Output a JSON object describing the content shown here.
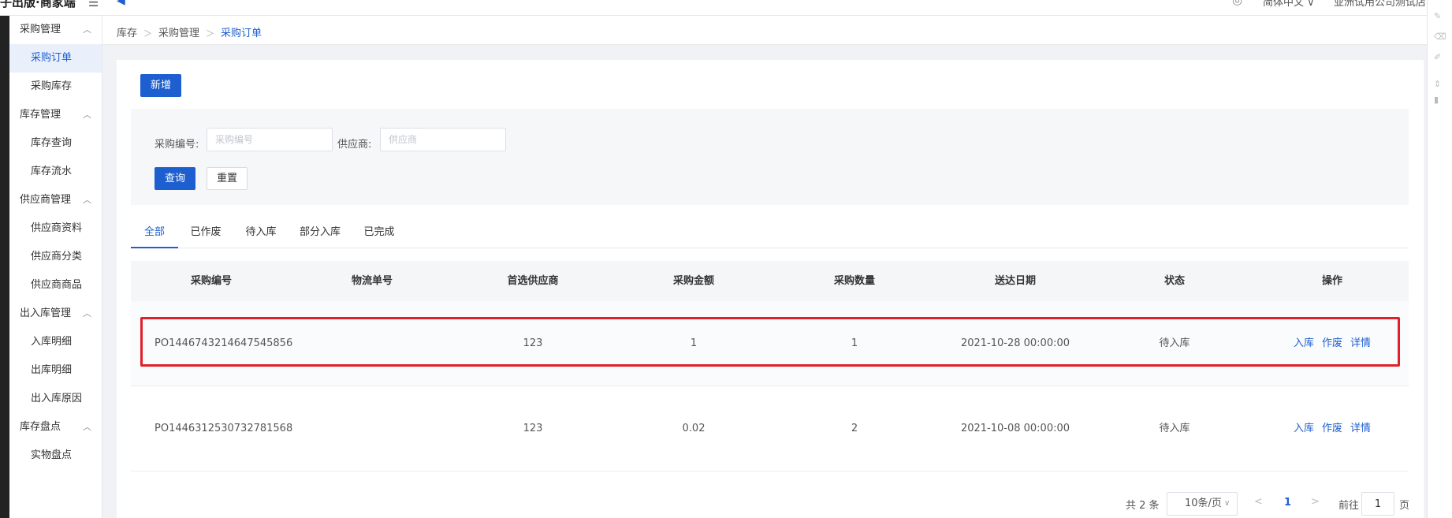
{
  "topbar": {
    "brand": "子出版·商家端",
    "menu_icon": "menu-icon",
    "user": "简体中文 ∨",
    "company": "亚洲试用公司测试店"
  },
  "sidebar": {
    "groups": [
      {
        "label": "采购管理",
        "items": [
          "采购订单",
          "采购库存"
        ]
      },
      {
        "label": "库存管理",
        "items": [
          "库存查询",
          "库存流水"
        ]
      },
      {
        "label": "供应商管理",
        "items": [
          "供应商资料",
          "供应商分类",
          "供应商商品"
        ]
      },
      {
        "label": "出入库管理",
        "items": [
          "入库明细",
          "出库明细",
          "出入库原因"
        ]
      },
      {
        "label": "库存盘点",
        "items": [
          "实物盘点"
        ]
      }
    ],
    "active_item": "采购订单"
  },
  "breadcrumb": {
    "items": [
      "库存",
      "采购管理"
    ],
    "current": "采购订单"
  },
  "toolbar": {
    "new_label": "新增"
  },
  "filter": {
    "po_label": "采购编号:",
    "po_placeholder": "采购编号",
    "supplier_label": "供应商:",
    "supplier_placeholder": "供应商",
    "query_label": "查询",
    "reset_label": "重置"
  },
  "tabs": [
    "全部",
    "已作废",
    "待入库",
    "部分入库",
    "已完成"
  ],
  "active_tab": "全部",
  "table": {
    "columns": [
      "采购编号",
      "物流单号",
      "首选供应商",
      "采购金额",
      "采购数量",
      "送达日期",
      "状态",
      "操作"
    ],
    "rows": [
      {
        "po": "PO1446743214647545856",
        "logistics": "",
        "supplier": "123",
        "amount": "1",
        "qty": "1",
        "date": "2021-10-28 00:00:00",
        "status": "待入库",
        "ops": [
          "入库",
          "作废",
          "详情"
        ]
      },
      {
        "po": "PO1446312530732781568",
        "logistics": "",
        "supplier": "123",
        "amount": "0.02",
        "qty": "2",
        "date": "2021-10-08 00:00:00",
        "status": "待入库",
        "ops": [
          "入库",
          "作废",
          "详情"
        ]
      }
    ]
  },
  "pagination": {
    "total": "共 2 条",
    "page_size": "10条/页",
    "current_page": "1",
    "goto_label": "前往",
    "goto_value": "1",
    "page_unit": "页"
  },
  "colors": {
    "primary": "#1e5fd0",
    "highlight": "#e0202a"
  }
}
